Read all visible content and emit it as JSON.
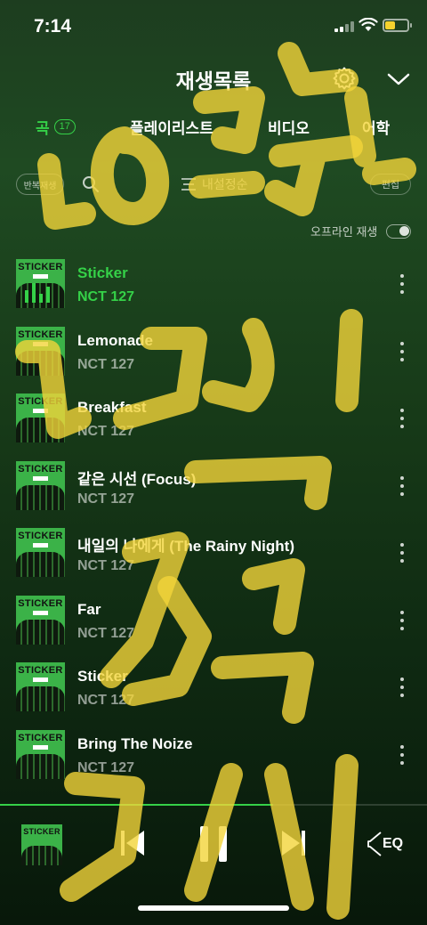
{
  "status_bar": {
    "time": "7:14"
  },
  "header": {
    "title": "재생목록"
  },
  "tabs": [
    {
      "label": "곡",
      "count": "17"
    },
    {
      "label": "플레이리스트"
    },
    {
      "label": "비디오"
    },
    {
      "label": "어학"
    }
  ],
  "toolbar": {
    "repeat_label": "반복재생",
    "sort_label": "내설정순",
    "edit_label": "편집"
  },
  "offline": {
    "label": "오프라인 재생"
  },
  "cover_text": "STICKER",
  "songs": [
    {
      "title": "Sticker",
      "artist": "NCT 127"
    },
    {
      "title": "Lemonade",
      "artist": "NCT 127"
    },
    {
      "title": "Breakfast",
      "artist": "NCT 127"
    },
    {
      "title": "같은 시선 (Focus)",
      "artist": "NCT 127"
    },
    {
      "title": "내일의 나에게 (The Rainy Night)",
      "artist": "NCT 127"
    },
    {
      "title": "Far",
      "artist": "NCT 127"
    },
    {
      "title": "Sticker",
      "artist": "NCT 127"
    },
    {
      "title": "Bring The Noize",
      "artist": "NCT 127"
    }
  ],
  "player": {
    "eq_label": "EQ",
    "progress": 0.64
  },
  "colors": {
    "accent": "#35d148",
    "brush": "#f2d43a"
  }
}
